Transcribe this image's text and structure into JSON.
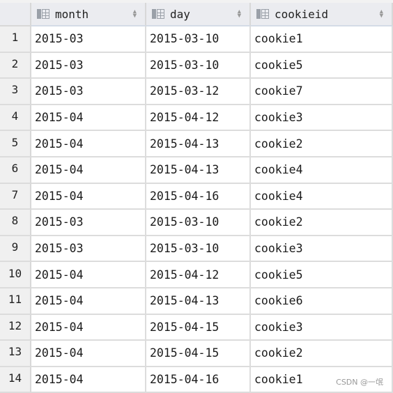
{
  "columns": [
    {
      "label": "month",
      "icon": "column-icon",
      "sort_icon": "sort-icon"
    },
    {
      "label": "day",
      "icon": "column-icon",
      "sort_icon": "sort-icon"
    },
    {
      "label": "cookieid",
      "icon": "column-icon",
      "sort_icon": "sort-icon"
    }
  ],
  "rows": [
    {
      "n": "1",
      "month": "2015-03",
      "day": "2015-03-10",
      "cookieid": "cookie1"
    },
    {
      "n": "2",
      "month": "2015-03",
      "day": "2015-03-10",
      "cookieid": "cookie5"
    },
    {
      "n": "3",
      "month": "2015-03",
      "day": "2015-03-12",
      "cookieid": "cookie7"
    },
    {
      "n": "4",
      "month": "2015-04",
      "day": "2015-04-12",
      "cookieid": "cookie3"
    },
    {
      "n": "5",
      "month": "2015-04",
      "day": "2015-04-13",
      "cookieid": "cookie2"
    },
    {
      "n": "6",
      "month": "2015-04",
      "day": "2015-04-13",
      "cookieid": "cookie4"
    },
    {
      "n": "7",
      "month": "2015-04",
      "day": "2015-04-16",
      "cookieid": "cookie4"
    },
    {
      "n": "8",
      "month": "2015-03",
      "day": "2015-03-10",
      "cookieid": "cookie2"
    },
    {
      "n": "9",
      "month": "2015-03",
      "day": "2015-03-10",
      "cookieid": "cookie3"
    },
    {
      "n": "10",
      "month": "2015-04",
      "day": "2015-04-12",
      "cookieid": "cookie5"
    },
    {
      "n": "11",
      "month": "2015-04",
      "day": "2015-04-13",
      "cookieid": "cookie6"
    },
    {
      "n": "12",
      "month": "2015-04",
      "day": "2015-04-15",
      "cookieid": "cookie3"
    },
    {
      "n": "13",
      "month": "2015-04",
      "day": "2015-04-15",
      "cookieid": "cookie2"
    },
    {
      "n": "14",
      "month": "2015-04",
      "day": "2015-04-16",
      "cookieid": "cookie1"
    }
  ],
  "watermark": "CSDN @一氓"
}
